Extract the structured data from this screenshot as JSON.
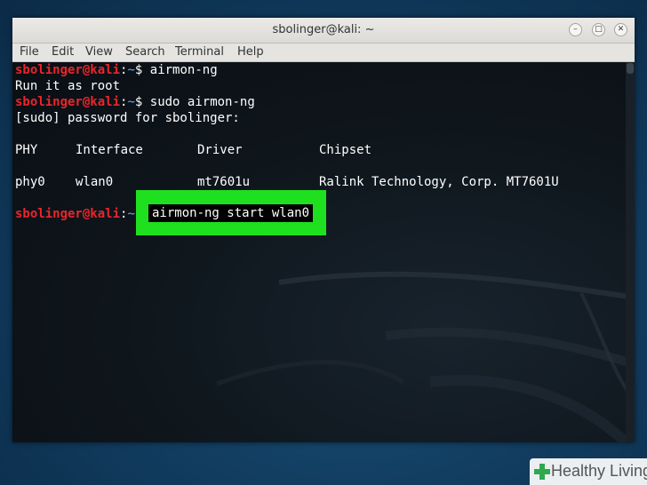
{
  "window": {
    "title": "sbolinger@kali: ~",
    "buttons": {
      "minimize": "–",
      "maximize": "□",
      "close": "✕"
    }
  },
  "menu": [
    "File",
    "Edit",
    "View",
    "Search",
    "Terminal",
    "Help"
  ],
  "prompt": {
    "user_host": "sbolinger@kali",
    "path": "~",
    "symbol": "$"
  },
  "lines": {
    "l1_cmd": "airmon-ng",
    "l2_output": "Run it as root",
    "l3_cmd": "sudo airmon-ng",
    "l4_output": "[sudo] password for sbolinger:"
  },
  "table": {
    "headers": [
      "PHY",
      "Interface",
      "Driver",
      "Chipset"
    ],
    "rows": [
      [
        "phy0",
        "wlan0",
        "mt7601u",
        "Ralink Technology, Corp. MT7601U"
      ]
    ]
  },
  "highlighted_command": "airmon-ng start wlan0",
  "colors": {
    "highlight": "#1ee01e",
    "user": "#e8262d",
    "path": "#6aa5ff"
  },
  "watermark": {
    "text": "Healthy Living"
  }
}
